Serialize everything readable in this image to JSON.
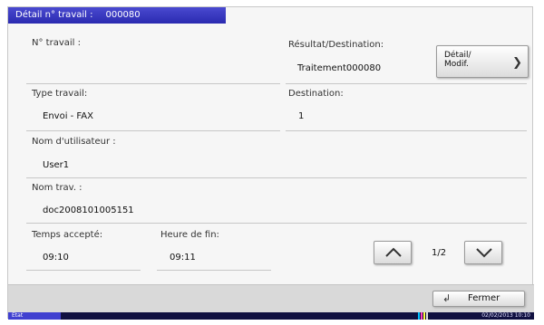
{
  "title_bar": {
    "label": "Détail n° travail :",
    "job_id": "000080"
  },
  "fields": {
    "job_no_label": "N° travail :",
    "result_label": "Résultat/Destination:",
    "result_value": "Traitement000080",
    "type_label": "Type travail:",
    "type_value": "Envoi - FAX",
    "dest_label": "Destination:",
    "dest_value": "1",
    "user_label": "Nom d'utilisateur :",
    "user_value": "User1",
    "name_label": "Nom trav. :",
    "name_value": "doc2008101005151",
    "accepted_label": "Temps accepté:",
    "accepted_value": "09:10",
    "end_label": "Heure de fin:",
    "end_value": "09:11"
  },
  "buttons": {
    "detail_label": "Détail/\nModif.",
    "close_label": "Fermer"
  },
  "pager": {
    "page": "1/2"
  },
  "status_bar": {
    "tab_label": "État",
    "datetime": "02/02/2013 10:10"
  },
  "icons": [
    "chevron-right-icon",
    "chevron-up-icon",
    "chevron-down-icon",
    "return-arrow-icon"
  ],
  "colors": {
    "title_bar": "#3535c0",
    "status_bar": "#101040",
    "status_tab": "#4040d0"
  }
}
